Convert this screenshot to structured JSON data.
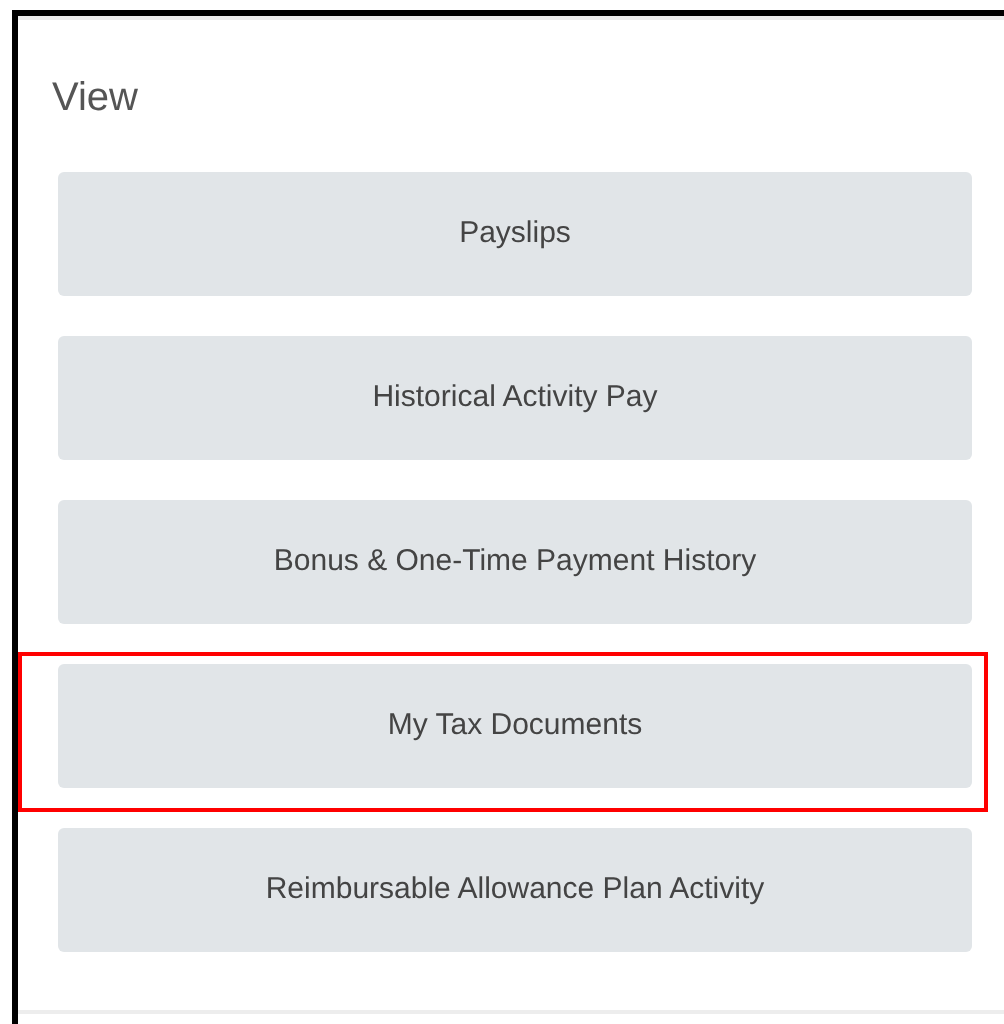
{
  "panel": {
    "title": "View",
    "buttons": [
      {
        "label": "Payslips",
        "highlighted": false
      },
      {
        "label": "Historical Activity Pay",
        "highlighted": false
      },
      {
        "label": "Bonus & One-Time Payment History",
        "highlighted": false
      },
      {
        "label": "My Tax Documents",
        "highlighted": true
      },
      {
        "label": "Reimbursable Allowance Plan Activity",
        "highlighted": false
      }
    ]
  }
}
